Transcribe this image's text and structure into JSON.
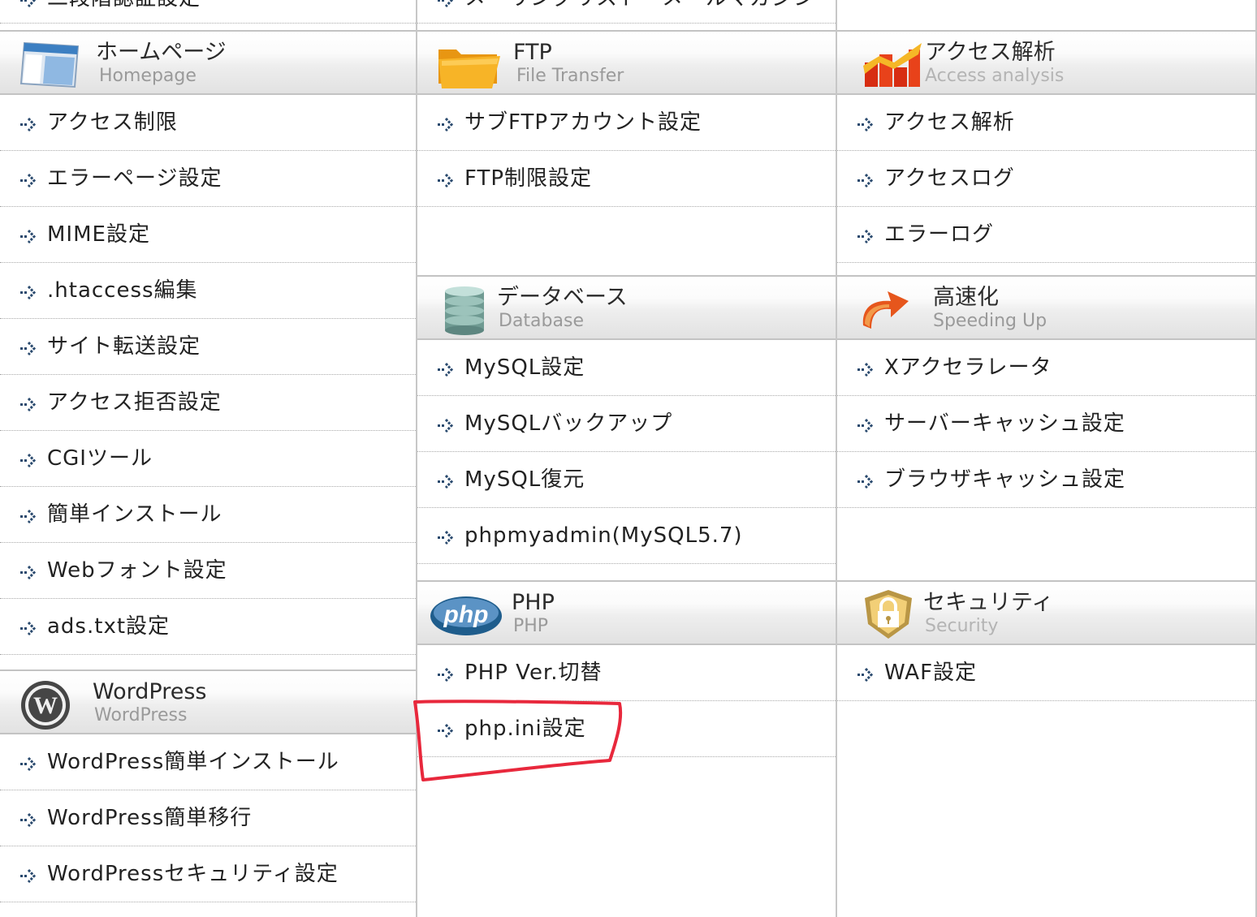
{
  "sections": {
    "homepage": {
      "title_ja": "ホームページ",
      "title_en": "Homepage",
      "icon": "browser-window-icon",
      "top_item": "二段階認証設定",
      "items": [
        {
          "label": "アクセス制限"
        },
        {
          "label": "エラーページ設定"
        },
        {
          "label": "MIME設定"
        },
        {
          "label": ".htaccess編集"
        },
        {
          "label": "サイト転送設定"
        },
        {
          "label": "アクセス拒否設定"
        },
        {
          "label": "CGIツール"
        },
        {
          "label": "簡単インストール"
        },
        {
          "label": "Webフォント設定"
        },
        {
          "label": "ads.txt設定"
        }
      ]
    },
    "wordpress": {
      "title_ja": "WordPress",
      "title_en": "WordPress",
      "icon": "wordpress-logo-icon",
      "items": [
        {
          "label": "WordPress簡単インストール"
        },
        {
          "label": "WordPress簡単移行"
        },
        {
          "label": "WordPressセキュリティ設定"
        }
      ]
    },
    "ftp": {
      "title_ja": "FTP",
      "title_en": "File Transfer",
      "icon": "folder-icon",
      "top_item": "メーリングリスト・メールマガジン",
      "items": [
        {
          "label": "サブFTPアカウント設定"
        },
        {
          "label": "FTP制限設定"
        }
      ]
    },
    "database": {
      "title_ja": "データベース",
      "title_en": "Database",
      "icon": "database-icon",
      "items": [
        {
          "label": "MySQL設定"
        },
        {
          "label": "MySQLバックアップ"
        },
        {
          "label": "MySQL復元"
        },
        {
          "label": "phpmyadmin(MySQL5.7)"
        }
      ]
    },
    "php": {
      "title_ja": "PHP",
      "title_en": "PHP",
      "icon": "php-logo-icon",
      "icon_text": "php",
      "items": [
        {
          "label": "PHP Ver.切替"
        },
        {
          "label": "php.ini設定",
          "highlighted": true
        }
      ]
    },
    "access": {
      "title_ja": "アクセス解析",
      "title_en": "Access analysis",
      "icon": "bar-chart-icon",
      "items": [
        {
          "label": "アクセス解析"
        },
        {
          "label": "アクセスログ"
        },
        {
          "label": "エラーログ"
        }
      ]
    },
    "speed": {
      "title_ja": "高速化",
      "title_en": "Speeding Up",
      "icon": "speed-arrow-icon",
      "items": [
        {
          "label": "Xアクセラレータ"
        },
        {
          "label": "サーバーキャッシュ設定"
        },
        {
          "label": "ブラウザキャッシュ設定"
        }
      ]
    },
    "security": {
      "title_ja": "セキュリティ",
      "title_en": "Security",
      "icon": "padlock-shield-icon",
      "items": [
        {
          "label": "WAF設定"
        }
      ]
    }
  },
  "colors": {
    "annotation_red": "#e8283c",
    "item_arrow": "#2a4a6e",
    "header_border": "#c3c3c3"
  }
}
